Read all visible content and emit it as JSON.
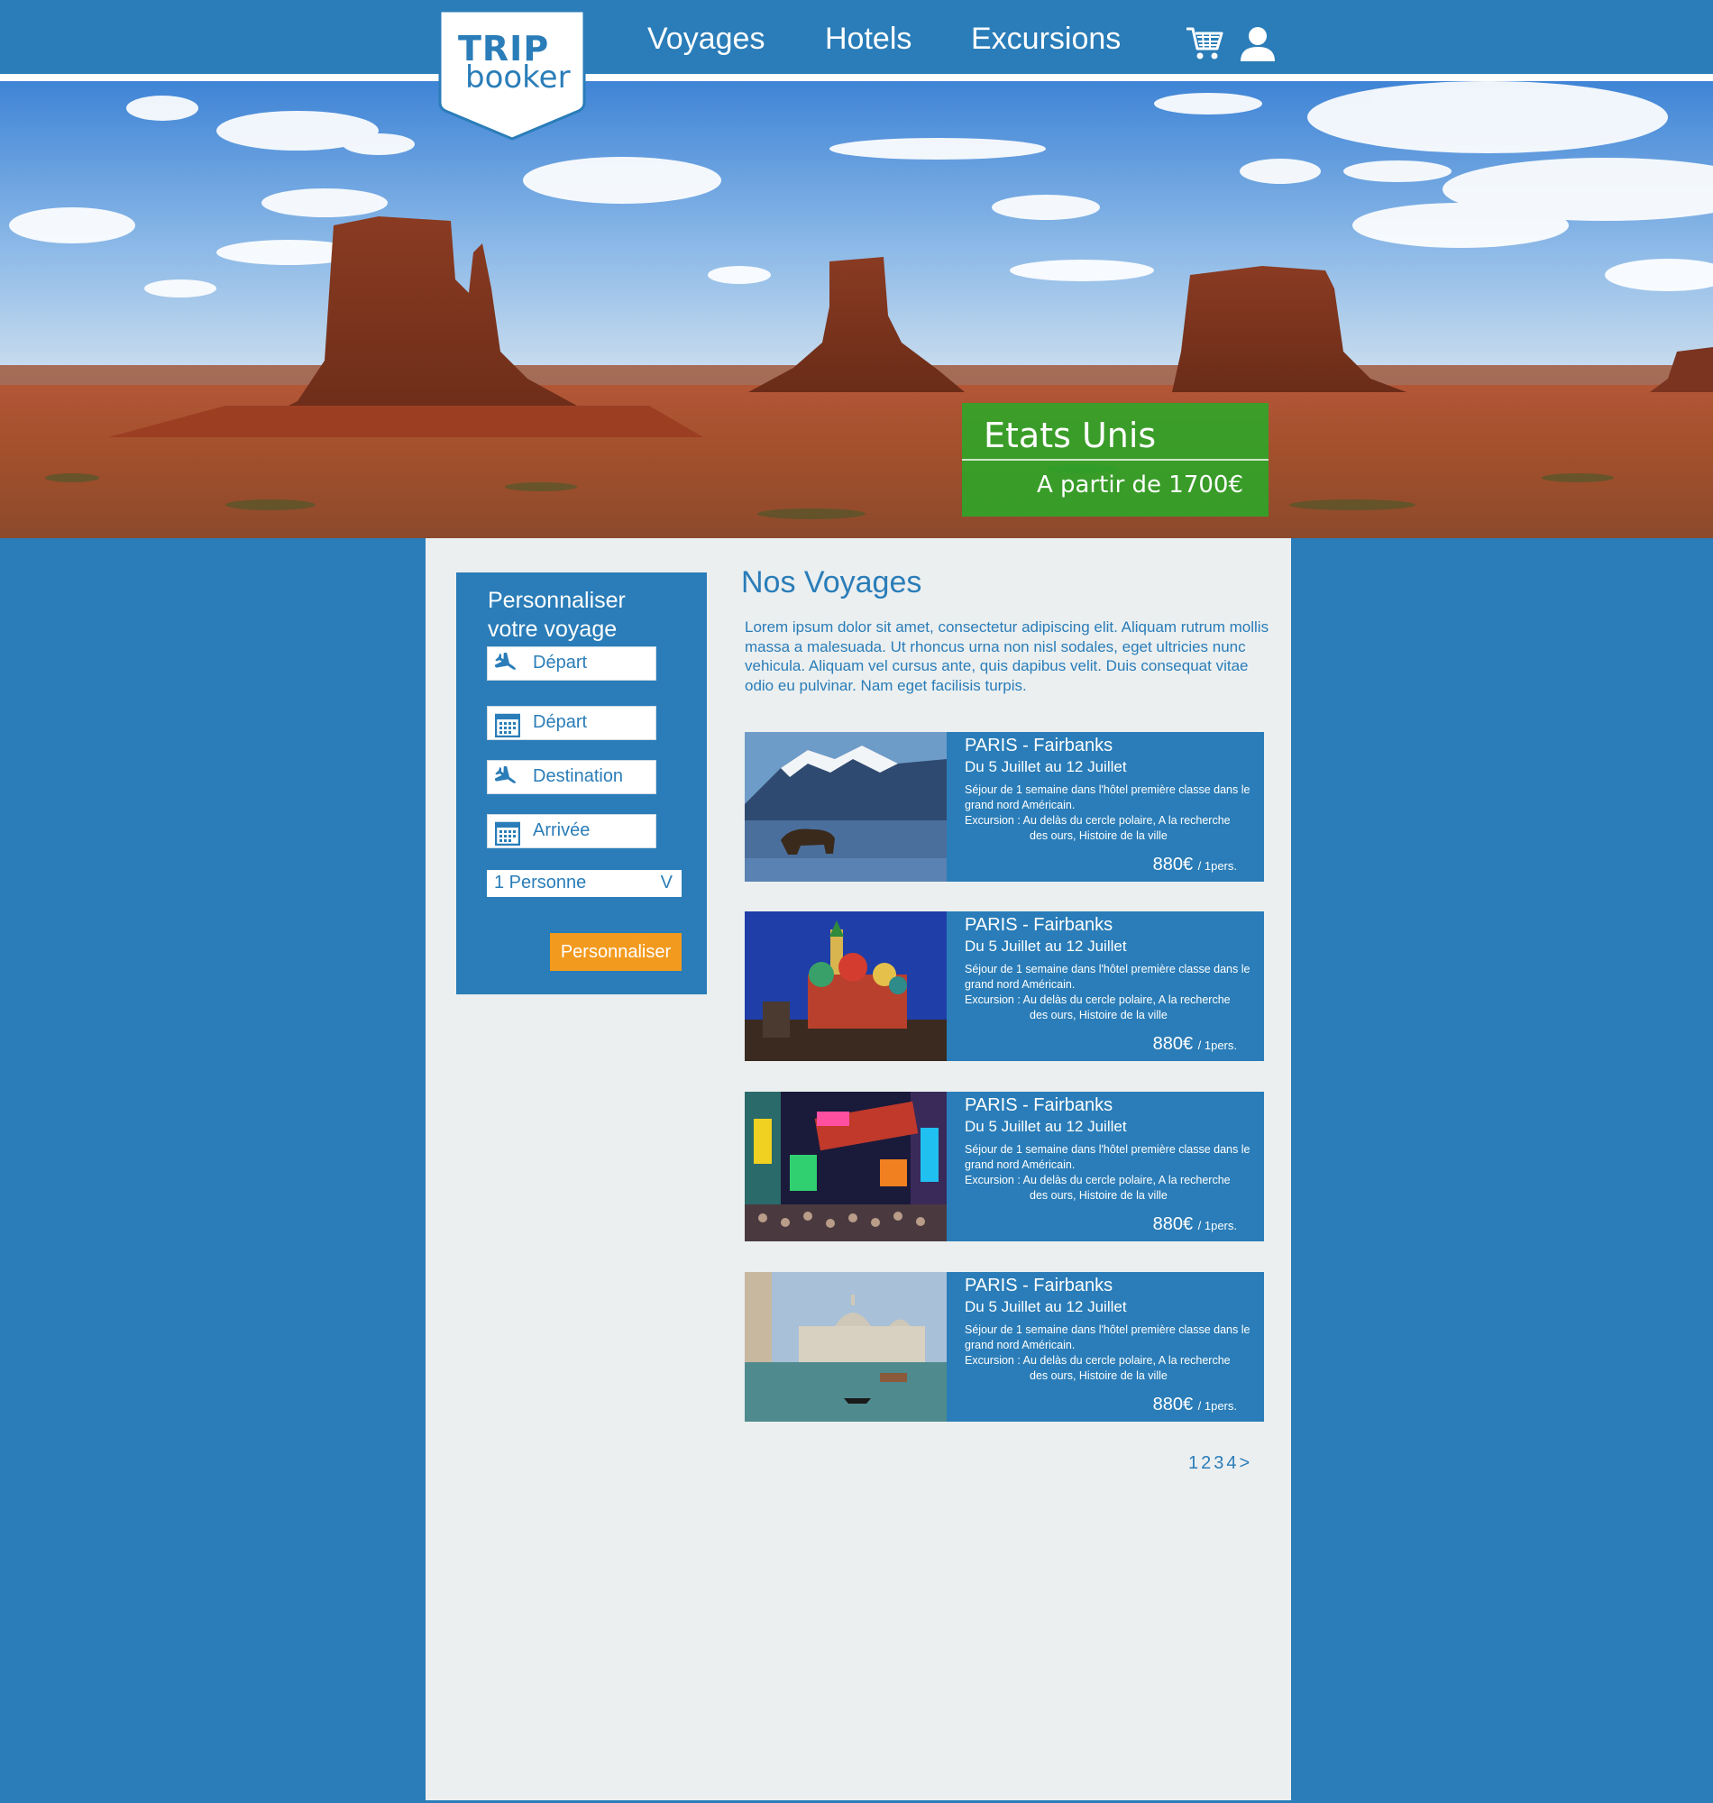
{
  "brand": {
    "logo_top": "TRIP",
    "logo_bottom": "booker"
  },
  "nav": {
    "items": [
      "Voyages",
      "Hotels",
      "Excursions"
    ]
  },
  "icons": {
    "cart": "cart-icon",
    "user": "user-icon",
    "plane": "plane-icon",
    "calendar": "calendar-icon"
  },
  "colors": {
    "primary": "#2a7db8",
    "panel": "#ebeff0",
    "accent": "#f29a1e",
    "promo": "#28aa28"
  },
  "hero": {
    "promo_title": "Etats Unis",
    "promo_price": "A partir de 1700€"
  },
  "search": {
    "title_line1": "Personnaliser",
    "title_line2": "votre voyage",
    "fields": [
      "Départ",
      "Départ",
      "Destination",
      "Arrivée"
    ],
    "persons": "1 Personne",
    "persons_arrow": "V",
    "submit": "Personnaliser"
  },
  "main": {
    "title": "Nos Voyages",
    "intro": "Lorem ipsum dolor sit amet, consectetur adipiscing elit. Aliquam rutrum mollis massa a malesuada. Ut rhoncus urna non nisl sodales, eget ultricies nunc vehicula. Aliquam vel cursus ante, quis dapibus velit. Duis consequat vitae odio eu pulvinar. Nam eget facilisis turpis."
  },
  "trips": [
    {
      "route": "PARIS - Fairbanks",
      "dates": "Du 5 Juillet au 12 Juillet",
      "desc": "Séjour de 1 semaine dans l'hôtel première classe dans le grand nord Américain.",
      "exc_line1": "Excursion : Au delàs du cercle polaire, A la recherche",
      "exc_line2": "des ours, Histoire de la ville",
      "price": "880€",
      "unit": "/ 1pers."
    },
    {
      "route": "PARIS - Fairbanks",
      "dates": "Du 5 Juillet au 12 Juillet",
      "desc": "Séjour de 1 semaine dans l'hôtel première classe dans le grand nord Américain.",
      "exc_line1": "Excursion : Au delàs du cercle polaire, A la recherche",
      "exc_line2": "des ours, Histoire de la ville",
      "price": "880€",
      "unit": "/ 1pers."
    },
    {
      "route": "PARIS - Fairbanks",
      "dates": "Du 5 Juillet au 12 Juillet",
      "desc": "Séjour de 1 semaine dans l'hôtel première classe dans le grand nord Américain.",
      "exc_line1": "Excursion : Au delàs du cercle polaire, A la recherche",
      "exc_line2": "des ours, Histoire de la ville",
      "price": "880€",
      "unit": "/ 1pers."
    },
    {
      "route": "PARIS - Fairbanks",
      "dates": "Du 5 Juillet au 12 Juillet",
      "desc": "Séjour de 1 semaine dans l'hôtel première classe dans le grand nord Américain.",
      "exc_line1": "Excursion : Au delàs du cercle polaire, A la recherche",
      "exc_line2": "des ours, Histoire de la ville",
      "price": "880€",
      "unit": "/ 1pers."
    }
  ],
  "pagination": {
    "pages": [
      "1",
      "2",
      "3",
      "4"
    ],
    "next": ">"
  }
}
